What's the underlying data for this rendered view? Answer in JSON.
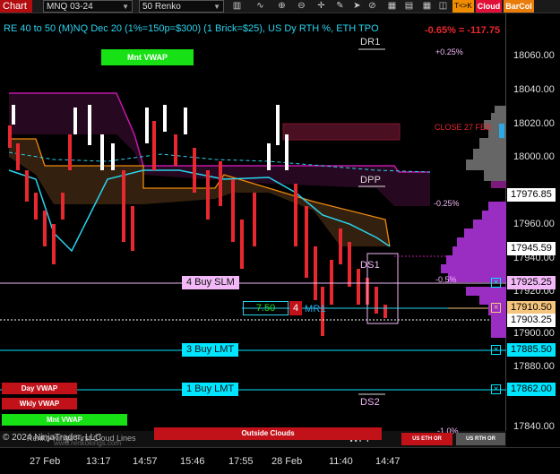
{
  "toolbar": {
    "chart_label": "Chart",
    "instrument": "MNQ 03-24",
    "bar_type": "50 Renko",
    "toggles": {
      "tk": "T<>K",
      "cloud": "Cloud",
      "barcol": "BarCol"
    }
  },
  "chart": {
    "title": "RE 40 to 50 (M)NQ Dec 20 (1%=150p=$300) (1 Brick=$25), US Dy RTH %, ETH TPO",
    "pl_value": "-0.65% = -117.75",
    "pct_levels": {
      "p025": "+0.25%",
      "m025": "-0.25%",
      "m05": "-0.5%",
      "m10": "-1.0%"
    },
    "level_labels": {
      "dr1": "DR1",
      "dpp": "DPP",
      "ds1": "DS1",
      "mr1": "MR1",
      "ds2": "DS2",
      "wpp": "WPP"
    },
    "close_label": "CLOSE 27 FEB",
    "mnt_vwap_label": "Mnt VWAP",
    "orders": {
      "buy_slm": "4 Buy SLM",
      "buy_lmt_3": "3 Buy LMT",
      "buy_lmt_1": "1 Buy LMT",
      "position_pnl": "7.50",
      "position_qty": "4"
    },
    "copyright": "© 2024 NinjaTrader, LLC",
    "indicator_label": "Renko-Kings First Cloud Lines",
    "watermark": "www.renkokings.com"
  },
  "y_axis": {
    "ticks": [
      "18060.00",
      "18040.00",
      "18020.00",
      "18000.00",
      "17960.00",
      "17940.00",
      "17920.00",
      "17900.00",
      "17880.00",
      "17840.00"
    ],
    "price_flags": [
      {
        "value": "17976.85",
        "color": "#ffffff"
      },
      {
        "value": "17945.59",
        "color": "#ffffff"
      },
      {
        "value": "17925.25",
        "color": "#f2b8f7"
      },
      {
        "value": "17910.50",
        "color": "#f5c57d"
      },
      {
        "value": "17903.25",
        "color": "#ffffff"
      },
      {
        "value": "17885.50",
        "color": "#00e5ff"
      },
      {
        "value": "17862.00",
        "color": "#00e5ff"
      }
    ]
  },
  "x_axis": {
    "ticks": [
      "27 Feb",
      "13:17",
      "14:57",
      "15:46",
      "17:55",
      "28 Feb",
      "11:40",
      "14:47"
    ]
  },
  "buttons": {
    "day_vwap": "Day VWAP",
    "wkly_vwap": "Wkly VWAP",
    "mnt_vwap": "Mnt VWAP",
    "outside_clouds": "Outside Clouds",
    "us_eth_or": "US ETH OR",
    "us_rth_or": "US RTH OR"
  },
  "colors": {
    "buy_slm": "#f2b8f7",
    "buy_lmt": "#00e5ff",
    "position_border": "#00e5ff",
    "loss_red": "#e8282f",
    "vwap_green": "#17e015",
    "title_cyan": "#29d3ee"
  }
}
